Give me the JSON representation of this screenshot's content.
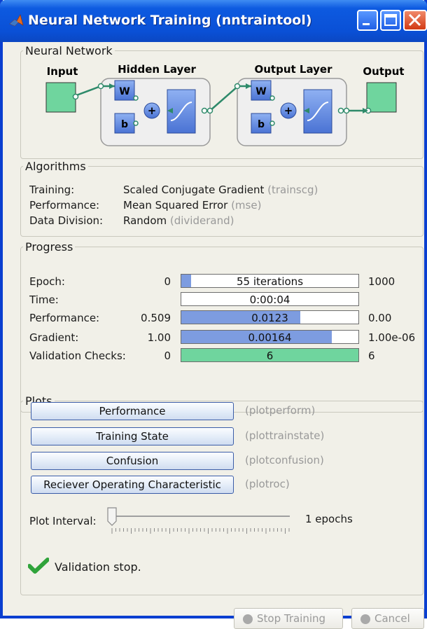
{
  "window": {
    "title": "Neural Network Training (nntraintool)"
  },
  "network": {
    "legend": "Neural Network",
    "input_label": "Input",
    "hidden_label": "Hidden Layer",
    "output_layer_label": "Output Layer",
    "output_label": "Output",
    "w_label": "W",
    "b_label": "b",
    "plus_label": "+"
  },
  "algorithms": {
    "legend": "Algorithms",
    "rows": [
      {
        "label": "Training:",
        "value": "Scaled Conjugate Gradient",
        "code": "(trainscg)"
      },
      {
        "label": "Performance:",
        "value": "Mean Squared Error",
        "code": "(mse)"
      },
      {
        "label": "Data Division:",
        "value": "Random",
        "code": "(dividerand)"
      }
    ]
  },
  "progress": {
    "legend": "Progress",
    "rows": [
      {
        "label": "Epoch:",
        "start": "0",
        "text": "55 iterations",
        "end": "1000",
        "fill": 0.055
      },
      {
        "label": "Time:",
        "start": "",
        "text": "0:00:04",
        "end": "",
        "fill": 0
      },
      {
        "label": "Performance:",
        "start": "0.509",
        "text": "0.0123",
        "end": "0.00",
        "fill": 0.67
      },
      {
        "label": "Gradient:",
        "start": "1.00",
        "text": "0.00164",
        "end": "1.00e-06",
        "fill": 0.85
      },
      {
        "label": "Validation Checks:",
        "start": "0",
        "text": "6",
        "end": "6",
        "fill": 1.0
      }
    ],
    "colors": {
      "bar": "#7d9ce0",
      "validation": "#6fd59e"
    }
  },
  "plots": {
    "legend": "Plots",
    "buttons": [
      {
        "label": "Performance",
        "code": "(plotperform)"
      },
      {
        "label": "Training State",
        "code": "(plottrainstate)"
      },
      {
        "label": "Confusion",
        "code": "(plotconfusion)"
      },
      {
        "label": "Reciever Operating Characteristic",
        "code": "(plotroc)"
      }
    ],
    "interval_label": "Plot Interval:",
    "interval_value": "1 epochs"
  },
  "status": {
    "message": "Validation stop.",
    "icon": "checkmark-icon"
  },
  "buttons": {
    "stop": "Stop Training",
    "cancel": "Cancel"
  }
}
